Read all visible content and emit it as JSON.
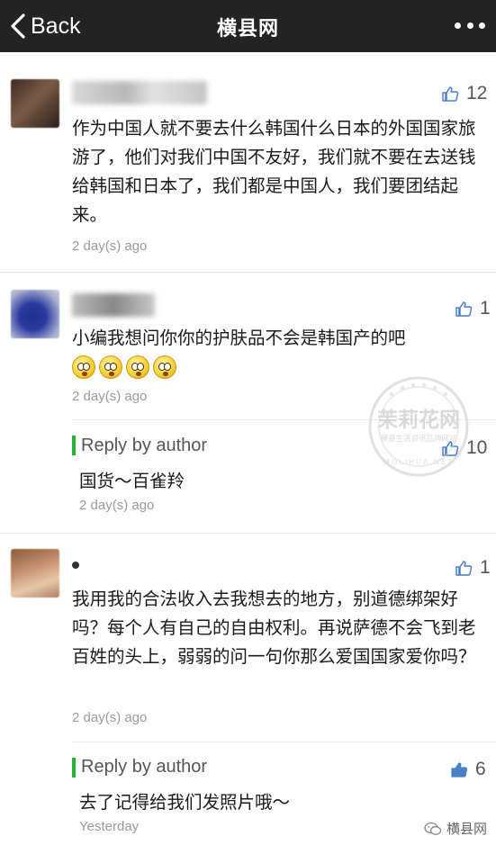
{
  "navbar": {
    "back_label": "Back",
    "title": "横县网"
  },
  "comments": [
    {
      "likes": "12",
      "text": "作为中国人就不要去什么韩国什么日本的外国国家旅游了，他们对我们中国不友好，我们就不要在去送钱给韩国和日本了，我们都是中国人，我们要团结起来。",
      "time": "2 day(s) ago"
    },
    {
      "likes": "1",
      "text": "小编我想问你你的护肤品不会是韩国产的吧",
      "emoji_count": 4,
      "time": "2 day(s) ago",
      "reply": {
        "label": "Reply by author",
        "likes": "10",
        "text": "国货～百雀羚",
        "time": "2 day(s) ago"
      }
    },
    {
      "likes": "1",
      "text": "我用我的合法收入去我想去的地方，别道德绑架好吗？每个人有自己的自由权利。再说萨德不会飞到老百姓的头上，弱弱的问一句你那么爱国国家爱你吗？",
      "time": "2 day(s) ago",
      "reply": {
        "label": "Reply by author",
        "likes": "6",
        "text": "去了记得给我们发照片哦～",
        "time": "Yesterday"
      }
    }
  ],
  "watermark": {
    "main": "茉莉花网",
    "sub": "横县生活资讯品牌网站",
    "ring": "MOLIHUA.NET"
  },
  "footer": {
    "label": "横县网",
    "icon": "wechat-icon"
  },
  "colors": {
    "navbar": "#232325",
    "reply_accent": "#27b33a",
    "secondary_text": "#9a9a9a"
  }
}
